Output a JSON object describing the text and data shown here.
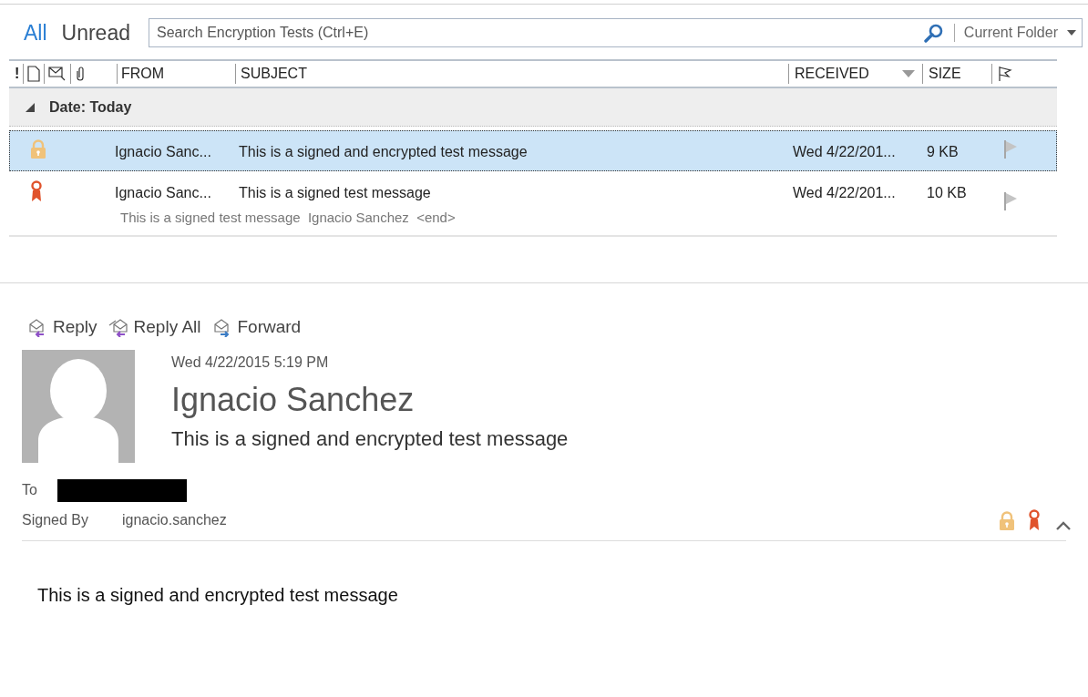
{
  "filters": [
    {
      "label": "All",
      "selected": true
    },
    {
      "label": "Unread",
      "selected": false
    }
  ],
  "search": {
    "placeholder": "Search Encryption Tests (Ctrl+E)",
    "scope": "Current Folder"
  },
  "columns": {
    "importance": "!",
    "from": "FROM",
    "subject": "SUBJECT",
    "received": "RECEIVED",
    "size": "SIZE"
  },
  "group": {
    "label": "Date: Today",
    "expanded": true
  },
  "messages": [
    {
      "kind": "encrypted",
      "from": "Ignacio Sanc...",
      "subject": "This is a signed and encrypted test message",
      "received": "Wed 4/22/201...",
      "size": "9 KB",
      "selected": true
    },
    {
      "kind": "signed",
      "from": "Ignacio Sanc...",
      "subject": "This is a signed test message",
      "received": "Wed 4/22/201...",
      "size": "10 KB",
      "selected": false,
      "preview": "This is a signed test message  Ignacio Sanchez  <end>"
    }
  ],
  "actions": [
    {
      "kind": "reply",
      "label": "Reply"
    },
    {
      "kind": "reply_all",
      "label": "Reply All"
    },
    {
      "kind": "forward",
      "label": "Forward"
    }
  ],
  "reading": {
    "date": "Wed 4/22/2015 5:19 PM",
    "sender": "Ignacio Sanchez",
    "subject": "This is a signed and encrypted test message",
    "to_label": "To",
    "signed_label": "Signed By",
    "signed_by": "ignacio.sanchez",
    "encrypted": true,
    "signed": true,
    "body": "This is a signed and encrypted test message"
  }
}
